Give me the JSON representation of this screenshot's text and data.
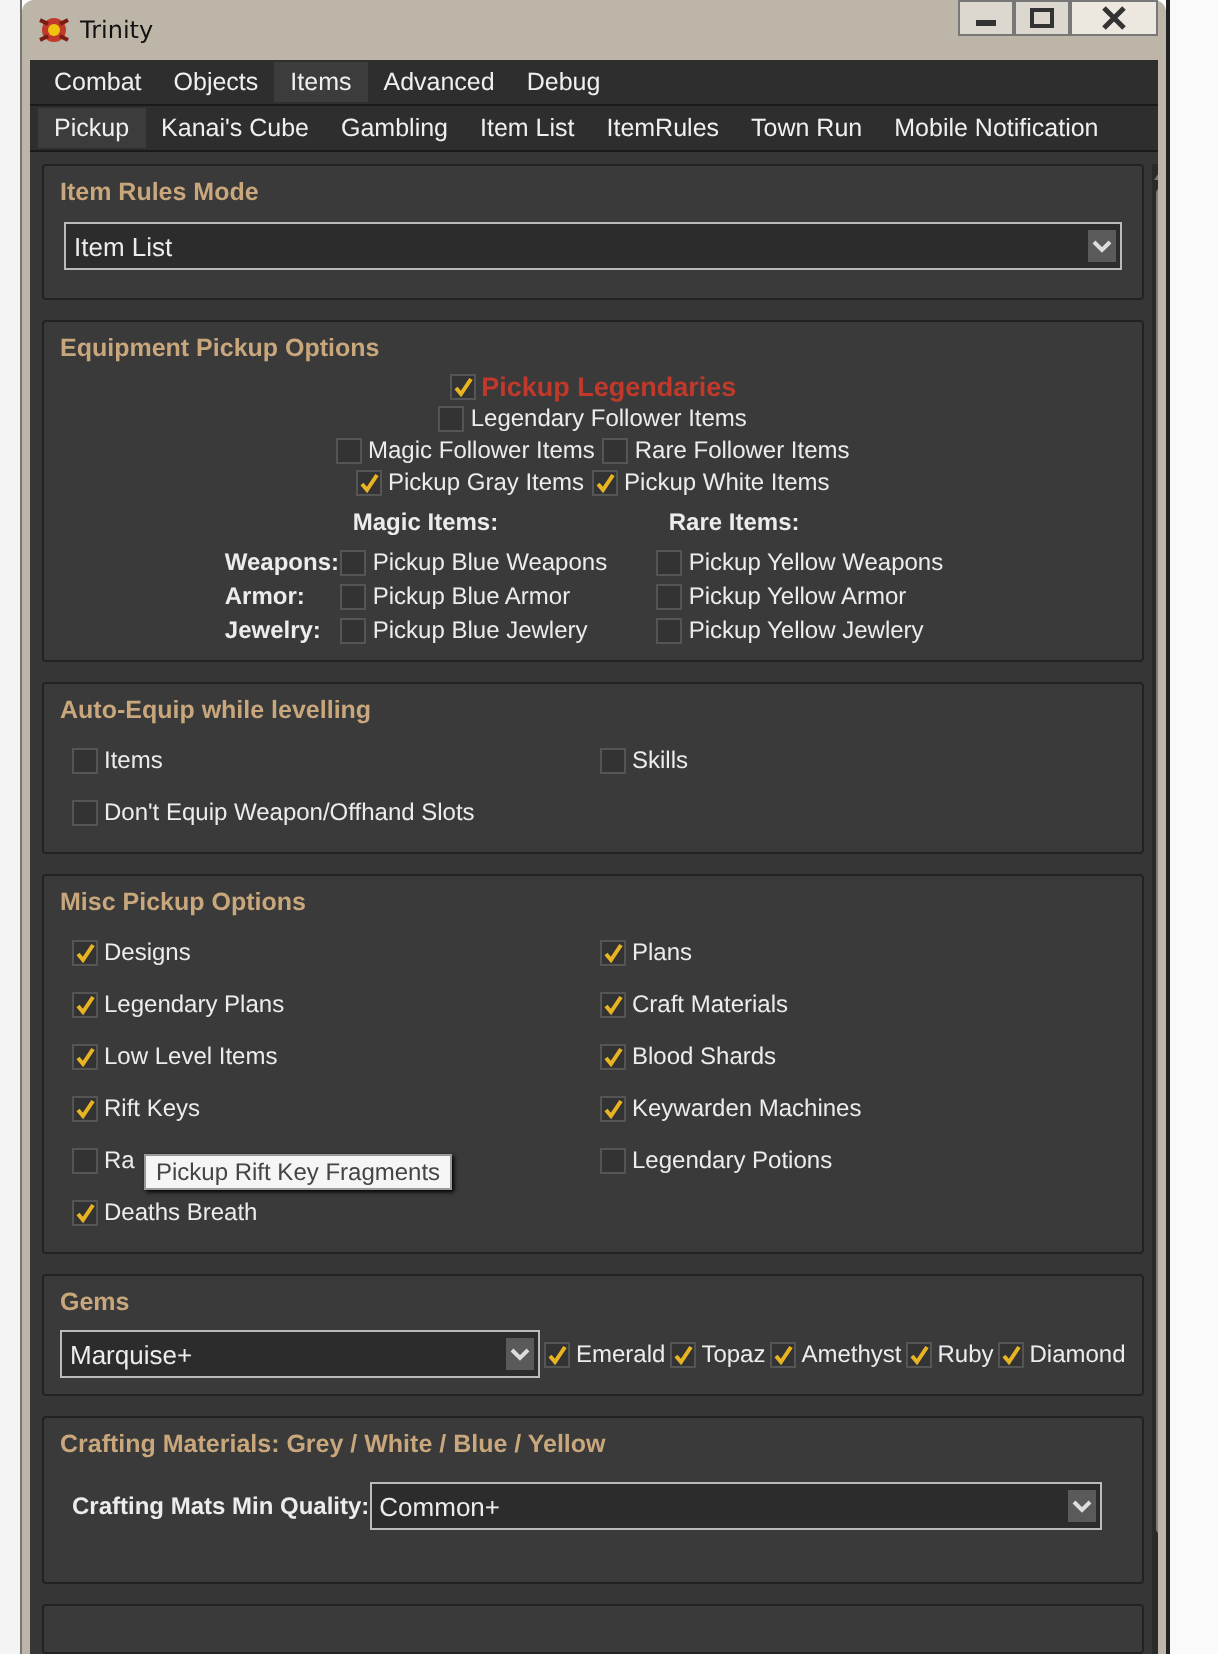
{
  "window": {
    "title": "Trinity"
  },
  "tabs_top": [
    {
      "label": "Combat",
      "selected": false
    },
    {
      "label": "Objects",
      "selected": false
    },
    {
      "label": "Items",
      "selected": true
    },
    {
      "label": "Advanced",
      "selected": false
    },
    {
      "label": "Debug",
      "selected": false
    }
  ],
  "tabs_sub": [
    {
      "label": "Pickup",
      "selected": true
    },
    {
      "label": "Kanai's Cube",
      "selected": false
    },
    {
      "label": "Gambling",
      "selected": false
    },
    {
      "label": "Item List",
      "selected": false
    },
    {
      "label": "ItemRules",
      "selected": false
    },
    {
      "label": "Town Run",
      "selected": false
    },
    {
      "label": "Mobile Notification",
      "selected": false
    }
  ],
  "sections": [
    {
      "kind": "mode",
      "title": "Item Rules Mode",
      "dropdown": {
        "value": "Item List"
      }
    },
    {
      "kind": "equipment",
      "title": "Equipment Pickup Options",
      "legendary": {
        "label": "Pickup Legendaries",
        "checked": true
      },
      "rows": [
        [
          {
            "label": "Legendary Follower Items",
            "checked": false
          }
        ],
        [
          {
            "label": "Magic Follower Items",
            "checked": false
          },
          {
            "label": "Rare Follower Items",
            "checked": false
          }
        ],
        [
          {
            "label": "Pickup Gray Items",
            "checked": true
          },
          {
            "label": "Pickup White Items",
            "checked": true
          }
        ]
      ],
      "magic_heading": "Magic Items:",
      "rare_heading": "Rare Items:",
      "slots": [
        {
          "label": "Weapons:",
          "magic": {
            "label": "Pickup Blue Weapons",
            "checked": false
          },
          "rare": {
            "label": "Pickup Yellow Weapons",
            "checked": false
          }
        },
        {
          "label": "Armor:",
          "magic": {
            "label": "Pickup Blue Armor",
            "checked": false
          },
          "rare": {
            "label": "Pickup Yellow Armor",
            "checked": false
          }
        },
        {
          "label": "Jewelry:",
          "magic": {
            "label": "Pickup Blue Jewlery",
            "checked": false
          },
          "rare": {
            "label": "Pickup Yellow Jewlery",
            "checked": false
          }
        }
      ]
    },
    {
      "kind": "grid",
      "title": "Auto-Equip while levelling",
      "left": [
        {
          "label": "Items",
          "checked": false
        },
        {
          "label": "Don't Equip Weapon/Offhand Slots",
          "checked": false
        }
      ],
      "right": [
        {
          "label": "Skills",
          "checked": false
        }
      ]
    },
    {
      "kind": "grid",
      "title": "Misc Pickup Options",
      "left": [
        {
          "label": "Designs",
          "checked": true
        },
        {
          "label": "Legendary Plans",
          "checked": true
        },
        {
          "label": "Low Level Items",
          "checked": true
        },
        {
          "label": "Rift Keys",
          "checked": true
        },
        {
          "label": "Ra",
          "checked": false
        },
        {
          "label": "Deaths Breath",
          "checked": true
        }
      ],
      "right": [
        {
          "label": "Plans",
          "checked": true
        },
        {
          "label": "Craft Materials",
          "checked": true
        },
        {
          "label": "Blood Shards",
          "checked": true
        },
        {
          "label": "Keywarden Machines",
          "checked": true
        },
        {
          "label": "Legendary Potions",
          "checked": false
        }
      ],
      "tooltip": "Pickup Rift Key Fragments"
    },
    {
      "kind": "gems",
      "title": "Gems",
      "dropdown": {
        "value": "Marquise+"
      },
      "gems": [
        {
          "label": "Emerald",
          "checked": true
        },
        {
          "label": "Topaz",
          "checked": true
        },
        {
          "label": "Amethyst",
          "checked": true
        },
        {
          "label": "Ruby",
          "checked": true
        },
        {
          "label": "Diamond",
          "checked": true
        }
      ]
    },
    {
      "kind": "crafting",
      "title": "Crafting Materials: Grey / White / Blue / Yellow",
      "label": "Crafting Mats Min Quality:",
      "dropdown": {
        "value": "Common+"
      }
    },
    {
      "kind": "empty"
    }
  ]
}
